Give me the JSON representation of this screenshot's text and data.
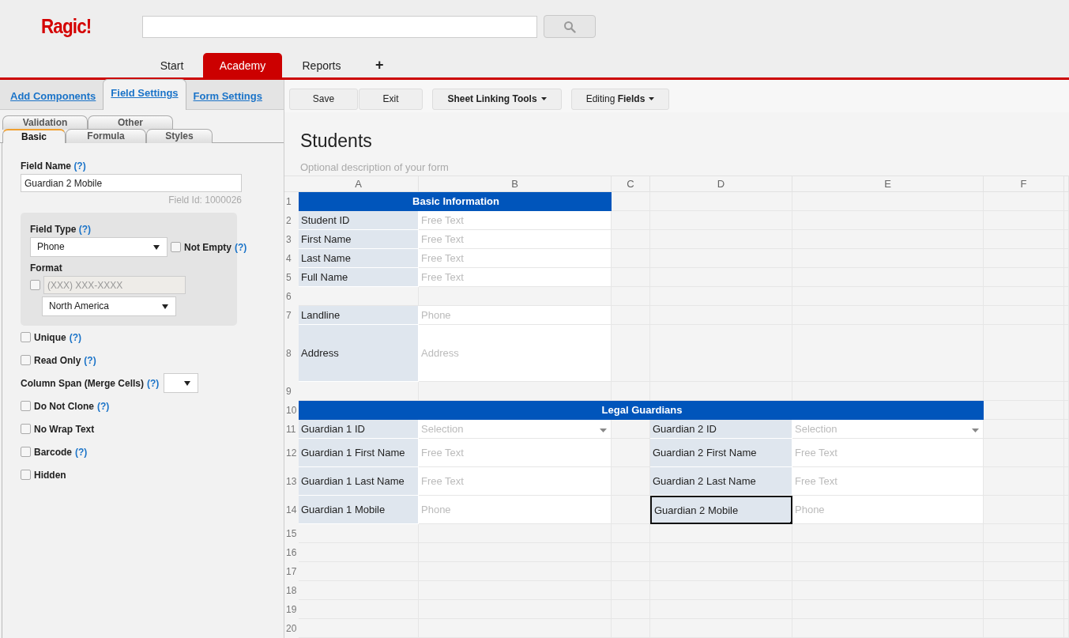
{
  "header": {
    "logo": "Ragic!"
  },
  "nav": {
    "tabs": [
      {
        "label": "Start",
        "selected": false
      },
      {
        "label": "Academy",
        "selected": true
      },
      {
        "label": "Reports",
        "selected": false
      }
    ],
    "add": "+"
  },
  "panel": {
    "tabs": [
      {
        "label": "Add Components",
        "selected": false
      },
      {
        "label": "Field Settings",
        "selected": true
      },
      {
        "label": "Form Settings",
        "selected": false
      }
    ],
    "subtabs": [
      [
        {
          "label": "Validation",
          "selected": false
        },
        {
          "label": "Other",
          "selected": false
        }
      ],
      [
        {
          "label": "Basic",
          "selected": true
        },
        {
          "label": "Formula",
          "selected": false
        },
        {
          "label": "Styles",
          "selected": false
        }
      ]
    ],
    "field_name": {
      "label": "Field Name",
      "help": "(?)",
      "value": "Guardian 2 Mobile",
      "field_id": "Field Id: 1000026"
    },
    "type_box": {
      "label": "Field Type",
      "help": "(?)",
      "value": "Phone",
      "not_empty": {
        "label": "Not Empty",
        "help": "(?)",
        "checked": false
      },
      "format_label": "Format",
      "format_checked": false,
      "format_placeholder": "(XXX) XXX-XXXX",
      "region": "North America"
    },
    "options": [
      {
        "kind": "checkbox",
        "label": "Unique",
        "help": "(?)",
        "checked": false
      },
      {
        "kind": "checkbox",
        "label": "Read Only",
        "help": "(?)",
        "checked": false
      },
      {
        "kind": "select",
        "label": "Column Span (Merge Cells)",
        "help": "(?)"
      },
      {
        "kind": "checkbox",
        "label": "Do Not Clone",
        "help": "(?)",
        "checked": false
      },
      {
        "kind": "checkbox",
        "label": "No Wrap Text",
        "checked": false
      },
      {
        "kind": "checkbox",
        "label": "Barcode",
        "help": "(?)",
        "checked": false
      },
      {
        "kind": "checkbox",
        "label": "Hidden",
        "checked": false
      }
    ]
  },
  "toolbar": [
    [
      {
        "label": "Save",
        "caret": false
      },
      {
        "label": "Exit",
        "caret": false
      }
    ],
    [
      {
        "label": "Sheet Linking Tools",
        "caret": true
      }
    ],
    [
      {
        "label": "Editing **Fields**",
        "caret": true
      }
    ]
  ],
  "form": {
    "title": "Students",
    "description": "Optional description of your form"
  },
  "sheet": {
    "columns": [
      "A",
      "B",
      "C",
      "D",
      "E",
      "F"
    ],
    "rows": [
      {
        "number": "1",
        "section": "Basic Information",
        "cells": [
          {
            "kind": "section"
          },
          {
            "kind": "merged"
          }
        ]
      },
      {
        "number": "2",
        "cells": [
          {
            "kind": "label",
            "text": "Student ID",
            "selected": false
          },
          {
            "kind": "input",
            "text": "Free Text"
          }
        ]
      },
      {
        "number": "3",
        "cells": [
          {
            "kind": "label",
            "text": "First Name",
            "selected": false
          },
          {
            "kind": "input",
            "text": "Free Text"
          }
        ]
      },
      {
        "number": "4",
        "cells": [
          {
            "kind": "label",
            "text": "Last Name",
            "selected": false
          },
          {
            "kind": "input",
            "text": "Free Text"
          }
        ]
      },
      {
        "number": "5",
        "cells": [
          {
            "kind": "label",
            "text": "Full Name",
            "selected": false
          },
          {
            "kind": "input",
            "text": "Free Text"
          }
        ]
      },
      {
        "number": "6",
        "cells": []
      },
      {
        "number": "7",
        "cells": [
          {
            "kind": "label",
            "text": "Landline",
            "selected": false
          },
          {
            "kind": "input",
            "text": "Phone"
          }
        ]
      },
      {
        "number": "8",
        "cells": [
          {
            "kind": "label",
            "text": "Address",
            "selected": false
          },
          {
            "kind": "input",
            "text": "Address"
          }
        ]
      },
      {
        "number": "9",
        "cells": []
      },
      {
        "number": "10",
        "section": "Legal Guardians",
        "cells": [
          {
            "kind": "section"
          },
          {
            "kind": "merged"
          },
          {
            "kind": "merged"
          },
          {
            "kind": "merged"
          },
          {
            "kind": "merged"
          }
        ]
      },
      {
        "number": "11",
        "cells": [
          {
            "kind": "label",
            "text": "Guardian 1 ID",
            "selected": false
          },
          {
            "kind": "select",
            "text": "Selection"
          },
          {
            "kind": "empty"
          },
          {
            "kind": "label",
            "text": "Guardian 2 ID",
            "selected": false
          },
          {
            "kind": "select",
            "text": "Selection"
          }
        ]
      },
      {
        "number": "12",
        "cells": [
          {
            "kind": "label",
            "text": "Guardian 1 First Name",
            "selected": false
          },
          {
            "kind": "input",
            "text": "Free Text"
          },
          {
            "kind": "empty"
          },
          {
            "kind": "label",
            "text": "Guardian 2 First Name",
            "selected": false
          },
          {
            "kind": "input",
            "text": "Free Text"
          }
        ]
      },
      {
        "number": "13",
        "cells": [
          {
            "kind": "label",
            "text": "Guardian 1 Last Name",
            "selected": false
          },
          {
            "kind": "input",
            "text": "Free Text"
          },
          {
            "kind": "empty"
          },
          {
            "kind": "label",
            "text": "Guardian 2 Last Name",
            "selected": false
          },
          {
            "kind": "input",
            "text": "Free Text"
          }
        ]
      },
      {
        "number": "14",
        "cells": [
          {
            "kind": "label",
            "text": "Guardian 1 Mobile",
            "selected": false
          },
          {
            "kind": "input",
            "text": "Phone"
          },
          {
            "kind": "empty"
          },
          {
            "kind": "label",
            "text": "Guardian 2 Mobile",
            "selected": true
          },
          {
            "kind": "input",
            "text": "Phone"
          }
        ]
      },
      {
        "number": "15",
        "cells": []
      },
      {
        "number": "16",
        "cells": []
      },
      {
        "number": "17",
        "cells": []
      },
      {
        "number": "18",
        "cells": []
      },
      {
        "number": "19",
        "cells": []
      },
      {
        "number": "20",
        "cells": []
      }
    ]
  }
}
